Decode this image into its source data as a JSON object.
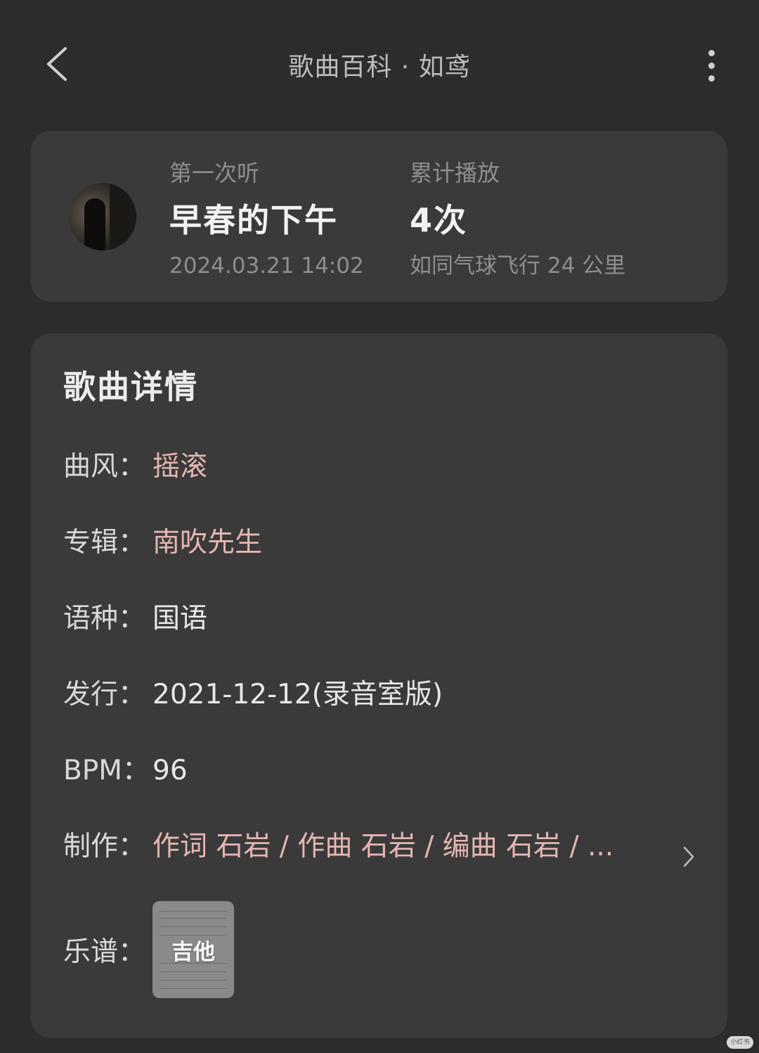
{
  "header": {
    "title": "歌曲百科 · 如鸢"
  },
  "listen_card": {
    "first_listen": {
      "label": "第一次听",
      "value": "早春的下午",
      "timestamp": "2024.03.21 14:02"
    },
    "play_count": {
      "label": "累计播放",
      "value": "4次",
      "comparison": "如同气球飞行 24 公里"
    }
  },
  "details": {
    "title": "歌曲详情",
    "genre": {
      "label": "曲风：",
      "value": "摇滚"
    },
    "album": {
      "label": "专辑：",
      "value": "南吹先生"
    },
    "language": {
      "label": "语种：",
      "value": "国语"
    },
    "release": {
      "label": "发行：",
      "value": "2021-12-12(录音室版)"
    },
    "bpm": {
      "label": "BPM：",
      "value": "96"
    },
    "credits": {
      "label": "制作：",
      "value": "作词 石岩 / 作曲 石岩 / 编曲 石岩 / ..."
    },
    "sheet": {
      "label": "乐谱：",
      "item": "吉他"
    }
  },
  "watermark": "小红书",
  "colors": {
    "background": "#2c2c2c",
    "card": "#3a3a3a",
    "link": "#e5b6b1"
  }
}
